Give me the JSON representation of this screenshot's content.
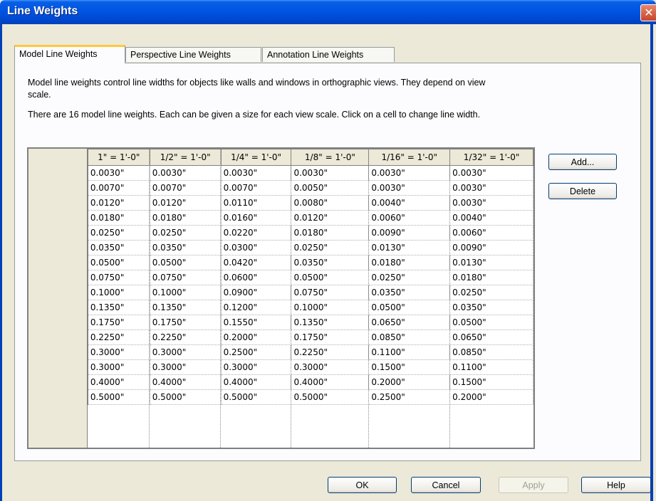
{
  "window": {
    "title": "Line Weights",
    "close_glyph": "✕"
  },
  "tabs": [
    {
      "label": "Model Line Weights",
      "active": true
    },
    {
      "label": "Perspective Line Weights",
      "active": false
    },
    {
      "label": "Annotation Line Weights",
      "active": false
    }
  ],
  "description": {
    "line1": "Model line weights control line widths for objects like walls and windows in orthographic views. They depend on view",
    "line2": "scale.",
    "line3": "There are 16 model line weights. Each can be given a size for each view scale. Click on a cell to change line width."
  },
  "grid": {
    "columns": [
      "1\" = 1'-0\"",
      "1/2\" = 1'-0\"",
      "1/4\" = 1'-0\"",
      "1/8\" = 1'-0\"",
      "1/16\" = 1'-0\"",
      "1/32\" = 1'-0\""
    ],
    "rows": [
      {
        "id": "1",
        "values": [
          "0.0030\"",
          "0.0030\"",
          "0.0030\"",
          "0.0030\"",
          "0.0030\"",
          "0.0030\""
        ]
      },
      {
        "id": "2",
        "values": [
          "0.0070\"",
          "0.0070\"",
          "0.0070\"",
          "0.0050\"",
          "0.0030\"",
          "0.0030\""
        ]
      },
      {
        "id": "3",
        "values": [
          "0.0120\"",
          "0.0120\"",
          "0.0110\"",
          "0.0080\"",
          "0.0040\"",
          "0.0030\""
        ]
      },
      {
        "id": "4",
        "values": [
          "0.0180\"",
          "0.0180\"",
          "0.0160\"",
          "0.0120\"",
          "0.0060\"",
          "0.0040\""
        ]
      },
      {
        "id": "5",
        "values": [
          "0.0250\"",
          "0.0250\"",
          "0.0220\"",
          "0.0180\"",
          "0.0090\"",
          "0.0060\""
        ]
      },
      {
        "id": "6",
        "values": [
          "0.0350\"",
          "0.0350\"",
          "0.0300\"",
          "0.0250\"",
          "0.0130\"",
          "0.0090\""
        ]
      },
      {
        "id": "7",
        "values": [
          "0.0500\"",
          "0.0500\"",
          "0.0420\"",
          "0.0350\"",
          "0.0180\"",
          "0.0130\""
        ]
      },
      {
        "id": "8",
        "values": [
          "0.0750\"",
          "0.0750\"",
          "0.0600\"",
          "0.0500\"",
          "0.0250\"",
          "0.0180\""
        ]
      },
      {
        "id": "9",
        "values": [
          "0.1000\"",
          "0.1000\"",
          "0.0900\"",
          "0.0750\"",
          "0.0350\"",
          "0.0250\""
        ]
      },
      {
        "id": "10",
        "values": [
          "0.1350\"",
          "0.1350\"",
          "0.1200\"",
          "0.1000\"",
          "0.0500\"",
          "0.0350\""
        ]
      },
      {
        "id": "11",
        "values": [
          "0.1750\"",
          "0.1750\"",
          "0.1550\"",
          "0.1350\"",
          "0.0650\"",
          "0.0500\""
        ]
      },
      {
        "id": "12",
        "values": [
          "0.2250\"",
          "0.2250\"",
          "0.2000\"",
          "0.1750\"",
          "0.0850\"",
          "0.0650\""
        ]
      },
      {
        "id": "13",
        "values": [
          "0.3000\"",
          "0.3000\"",
          "0.2500\"",
          "0.2250\"",
          "0.1100\"",
          "0.0850\""
        ]
      },
      {
        "id": "14",
        "values": [
          "0.3000\"",
          "0.3000\"",
          "0.3000\"",
          "0.3000\"",
          "0.1500\"",
          "0.1100\""
        ]
      },
      {
        "id": "15",
        "values": [
          "0.4000\"",
          "0.4000\"",
          "0.4000\"",
          "0.4000\"",
          "0.2000\"",
          "0.1500\""
        ]
      },
      {
        "id": "16",
        "values": [
          "0.5000\"",
          "0.5000\"",
          "0.5000\"",
          "0.5000\"",
          "0.2500\"",
          "0.2000\""
        ]
      }
    ]
  },
  "side_buttons": {
    "add": "Add...",
    "delete": "Delete"
  },
  "footer": {
    "ok": "OK",
    "cancel": "Cancel",
    "apply": "Apply",
    "help": "Help"
  }
}
